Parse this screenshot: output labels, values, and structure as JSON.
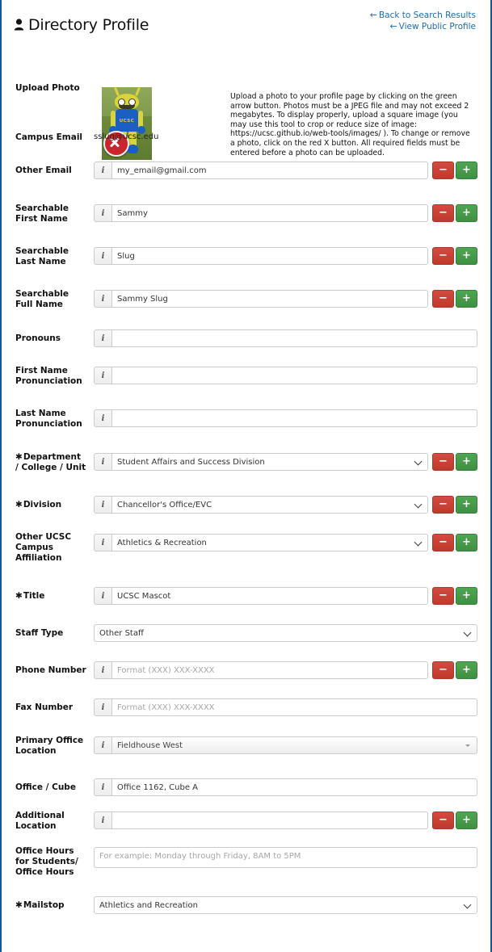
{
  "header": {
    "title": "Directory Profile",
    "title_icon": "person-icon",
    "links": [
      {
        "label": "Back to Search Results",
        "arrow": "←"
      },
      {
        "label": "View Public Profile",
        "arrow": "←"
      }
    ]
  },
  "upload": {
    "label": "Upload Photo",
    "photo_alt": "Sammy the Slug UCSC mascot",
    "photo_shirt_text": "UCSC",
    "delete_button": "remove-photo",
    "description": "Upload a photo to your profile page by clicking on the green arrow button. Photos must be a JPEG file and may not exceed 2 megabytes. To display properly, upload a square image (you may use this tool to crop or reduce size of image: https://ucsc.github.io/web-tools/images/ ). To change or remove a photo, click on the red X button. All required fields must be entered before a photo can be uploaded."
  },
  "icons": {
    "info": "i",
    "minus": "−",
    "plus": "+",
    "required_mark": "✱"
  },
  "colors": {
    "link": "#1a6bb5",
    "frame_border": "#15559a",
    "minus_button": "#c0392b",
    "plus_button": "#3f9142",
    "delete_photo": "#c9252d"
  },
  "fields": {
    "campus_email": {
      "label": "Campus Email",
      "value": "sslug@ucsc.edu"
    },
    "other_email": {
      "label": "Other Email",
      "value": "my_email@gmail.com",
      "placeholder": ""
    },
    "searchable_first_name": {
      "label": "Searchable First Name",
      "value": "Sammy"
    },
    "searchable_last_name": {
      "label": "Searchable Last Name",
      "value": "Slug"
    },
    "searchable_full_name": {
      "label": "Searchable Full Name",
      "value": "Sammy Slug"
    },
    "pronouns": {
      "label": "Pronouns",
      "value": ""
    },
    "first_name_pronunciation": {
      "label": "First Name Pronunciation",
      "value": ""
    },
    "last_name_pronunciation": {
      "label": "Last Name Pronunciation",
      "value": ""
    },
    "department": {
      "label": "Department / College / Unit",
      "required": "✱",
      "value": "Student Affairs and Success Division"
    },
    "division": {
      "label": "Division",
      "required": "✱",
      "value": "Chancellor's Office/EVC"
    },
    "other_affiliation": {
      "label": "Other UCSC Campus Affiliation",
      "value": "Athletics & Recreation"
    },
    "title": {
      "label": "Title",
      "required": "✱",
      "value": "UCSC Mascot"
    },
    "staff_type": {
      "label": "Staff Type",
      "value": "Other Staff"
    },
    "phone_number": {
      "label": "Phone Number",
      "value": "",
      "placeholder": "Format (XXX) XXX-XXXX"
    },
    "fax_number": {
      "label": "Fax Number",
      "value": "",
      "placeholder": "Format (XXX) XXX-XXXX"
    },
    "primary_office_location": {
      "label": "Primary Office Location",
      "value": "Fieldhouse West"
    },
    "office_cube": {
      "label": "Office / Cube",
      "value": "Office 1162, Cube A"
    },
    "additional_location": {
      "label": "Additional Location",
      "value": ""
    },
    "office_hours": {
      "label": "Office Hours for Students/ Office Hours",
      "value": "",
      "placeholder": "For example: Monday through Friday, 8AM to 5PM"
    },
    "mailstop": {
      "label": "Mailstop",
      "required": "✱",
      "value": "Athletics and Recreation"
    }
  }
}
